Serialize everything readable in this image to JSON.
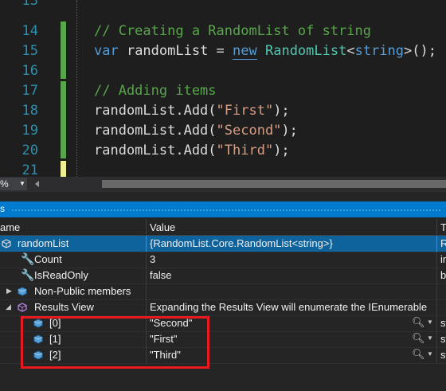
{
  "editor": {
    "lines": [
      {
        "num": "13",
        "code": ""
      },
      {
        "num": "14",
        "code": "// Creating a RandomList of string"
      },
      {
        "num": "15",
        "code": "var randomList = new RandomList<string>();"
      },
      {
        "num": "16",
        "code": ""
      },
      {
        "num": "17",
        "code": "// Adding items"
      },
      {
        "num": "18",
        "code": "randomList.Add(\"First\");"
      },
      {
        "num": "19",
        "code": "randomList.Add(\"Second\");"
      },
      {
        "num": "20",
        "code": "randomList.Add(\"Third\");"
      },
      {
        "num": "21",
        "code": ""
      }
    ],
    "tokens": {
      "l14_comment": "// Creating a RandomList of string",
      "l15_var": "var",
      "l15_name": " randomList = ",
      "l15_new": "new",
      "l15_sp": " ",
      "l15_type": "RandomList",
      "l15_lt": "<",
      "l15_string": "string",
      "l15_end": ">();",
      "l17_comment": "// Adding items",
      "l18_call": "randomList.Add(",
      "l18_arg": "\"First\"",
      "l18_end": ");",
      "l19_call": "randomList.Add(",
      "l19_arg": "\"Second\"",
      "l19_end": ");",
      "l20_call": "randomList.Add(",
      "l20_arg": "\"Third\"",
      "l20_end": ");"
    },
    "zoom": "%"
  },
  "panel": {
    "title": "s",
    "columns": {
      "name": "ame",
      "value": "Value",
      "type": "T"
    },
    "rows": [
      {
        "name": "randomList",
        "value": "{RandomList.Core.RandomList<string>}",
        "type": "R"
      },
      {
        "name": "Count",
        "value": "3",
        "type": "in"
      },
      {
        "name": "IsReadOnly",
        "value": "false",
        "type": "b"
      },
      {
        "name": "Non-Public members",
        "value": "",
        "type": ""
      },
      {
        "name": "Results View",
        "value": "Expanding the Results View will enumerate the IEnumerable",
        "type": ""
      },
      {
        "name": "[0]",
        "value": "\"Second\"",
        "type": "st"
      },
      {
        "name": "[1]",
        "value": "\"First\"",
        "type": "st"
      },
      {
        "name": "[2]",
        "value": "\"Third\"",
        "type": "st"
      }
    ]
  },
  "colors": {
    "accent": "#007acc",
    "selection": "#0e639c",
    "highlight_box": "#e8191f",
    "comment": "#57a64a",
    "keyword": "#569cd6",
    "type": "#4ec9b0",
    "string": "#d69d85"
  }
}
